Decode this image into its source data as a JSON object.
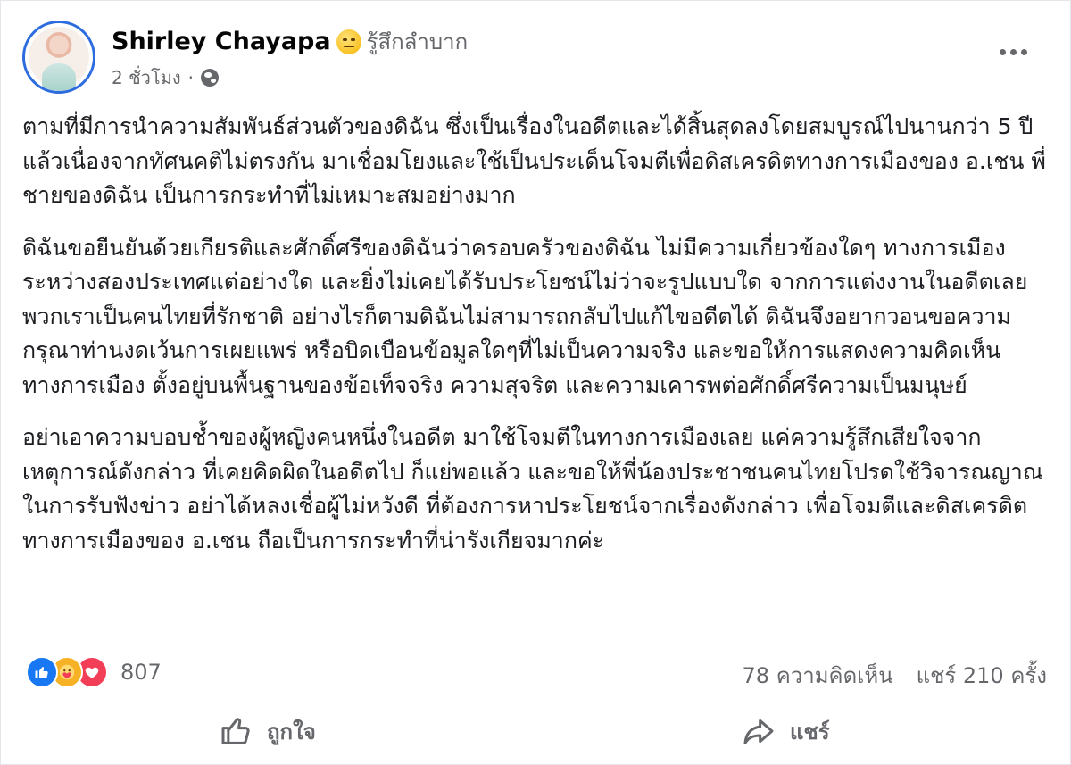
{
  "post": {
    "author": "Shirley Chayapa",
    "feeling": "รู้สึกลำบาก",
    "feeling_icon": "neutral-face-emoji",
    "time": "2 ชั่วโมง",
    "separator": "·",
    "privacy_icon": "globe-icon"
  },
  "body": {
    "paragraphs": [
      "ตามที่มีการนำความสัมพันธ์ส่วนตัวของดิฉัน ซึ่งเป็นเรื่องในอดีตและได้สิ้นสุดลงโดยสมบูรณ์ไปนานกว่า 5 ปีแล้วเนื่องจากทัศนคติไม่ตรงกัน มาเชื่อมโยงและใช้เป็นประเด็นโจมตีเพื่อดิสเครดิตทางการเมืองของ อ.เชน พี่ชายของดิฉัน เป็นการกระทำที่ไม่เหมาะสมอย่างมาก",
      "ดิฉันขอยืนยันด้วยเกียรติและศักดิ์ศรีของดิฉันว่าครอบครัวของดิฉัน ไม่มีความเกี่ยวข้องใดๆ ทางการเมืองระหว่างสองประเทศแต่อย่างใด และยิ่งไม่เคยได้รับประโยชน์ไม่ว่าจะรูปแบบใด จากการแต่งงานในอดีตเลย พวกเราเป็นคนไทยที่รักชาติ อย่างไรก็ตามดิฉันไม่สามารถกลับไปแก้ไขอดีตได้ ดิฉันจึงอยากวอนขอความกรุณาท่านงดเว้นการเผยแพร่ หรือบิดเบือนข้อมูลใดๆที่ไม่เป็นความจริง และขอให้การแสดงความคิดเห็นทางการเมือง ตั้งอยู่บนพื้นฐานของข้อเท็จจริง ความสุจริต และความเคารพต่อศักดิ์ศรีความเป็นมนุษย์",
      "อย่าเอาความบอบช้ำของผู้หญิงคนหนึ่งในอดีต มาใช้โจมตีในทางการเมืองเลย แค่ความรู้สึกเสียใจจากเหตุการณ์ดังกล่าว ที่เคยคิดผิดในอดีตไป ก็แย่พอแล้ว และขอให้พี่น้องประชาชนคนไทยโปรดใช้วิจารณญาณในการรับฟังข่าว อย่าได้หลงเชื่อผู้ไม่หวังดี ที่ต้องการหาประโยชน์จากเรื่องดังกล่าว เพื่อโจมตีและดิสเครดิตทางการเมืองของ อ.เชน ถือเป็นการกระทำที่น่ารังเกียจมากค่ะ"
    ]
  },
  "reactions": {
    "icons": [
      "like-icon",
      "care-icon",
      "love-icon"
    ],
    "count": "807"
  },
  "stats": {
    "comments": "78 ความคิดเห็น",
    "shares": "แชร์ 210 ครั้ง"
  },
  "actions": {
    "like_label": "ถูกใจ",
    "share_label": "แชร์"
  },
  "colors": {
    "accent": "#1877f2",
    "secondary_text": "#65676b",
    "love": "#f33e58",
    "care": "#f7b125"
  }
}
